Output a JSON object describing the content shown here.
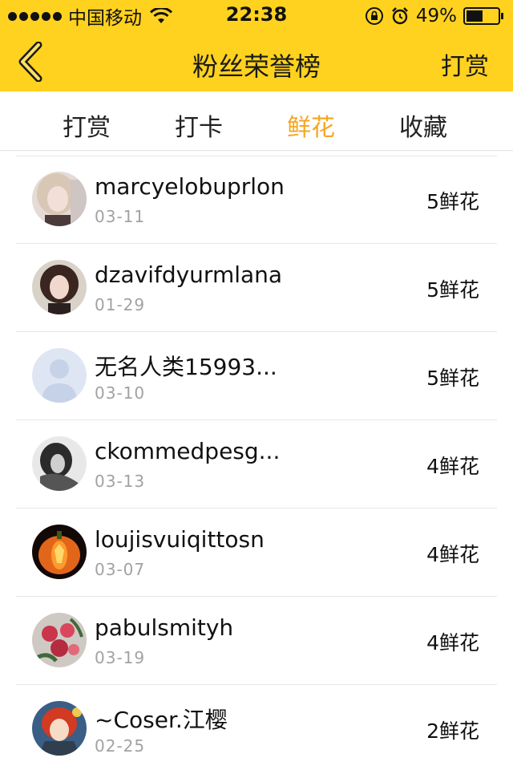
{
  "status_bar": {
    "carrier": "中国移动",
    "time": "22:38",
    "battery": "49%"
  },
  "nav": {
    "title": "粉丝荣誉榜",
    "right_label": "打赏"
  },
  "tabs": [
    {
      "label": "打赏"
    },
    {
      "label": "打卡"
    },
    {
      "label": "鲜花"
    },
    {
      "label": "收藏"
    }
  ],
  "active_tab_color": "#f5a623",
  "header_color": "#ffd21f",
  "list": [
    {
      "name": "marcyelobuprlon",
      "date": "03-11",
      "value": "5鲜花",
      "avatar": "photo-girl-light-hair"
    },
    {
      "name": "dzavifdyurmlana",
      "date": "01-29",
      "value": "5鲜花",
      "avatar": "photo-girl-bob-hair"
    },
    {
      "name": "无名人类15993...",
      "date": "03-10",
      "value": "5鲜花",
      "avatar": "default-user-placeholder"
    },
    {
      "name": "ckommedpesg...",
      "date": "03-13",
      "value": "4鲜花",
      "avatar": "photo-bw-portrait"
    },
    {
      "name": "loujisvuiqittosn",
      "date": "03-07",
      "value": "4鲜花",
      "avatar": "pumpkin-lantern"
    },
    {
      "name": "pabulsmityh",
      "date": "03-19",
      "value": "4鲜花",
      "avatar": "roses-painting"
    },
    {
      "name": "~Coser.江樱",
      "date": "02-25",
      "value": "2鲜花",
      "avatar": "anime-red-hair"
    }
  ]
}
